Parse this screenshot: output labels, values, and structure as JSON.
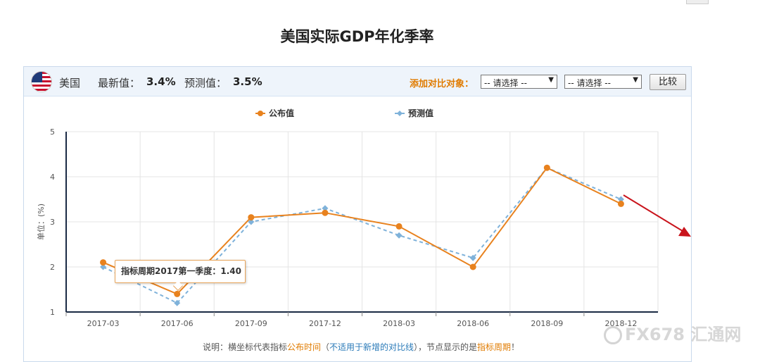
{
  "page": {
    "title": "美国实际GDP年化季率"
  },
  "header": {
    "country": "美国",
    "latest_label": "最新值：",
    "latest_value": "3.4%",
    "forecast_label": "预测值：",
    "forecast_value": "3.5%",
    "compare_label": "添加对比对象：",
    "select1": "-- 请选择 --",
    "select2": "-- 请选择 --",
    "compare_button": "比较"
  },
  "tooltip": {
    "text": "指标周期2017第一季度：1.40"
  },
  "note": {
    "p1": "说明：横坐标代表指标",
    "p2": "公布时间",
    "p3": "（",
    "p4": "不适用于新增的对比线",
    "p5": "），节点显示的是",
    "p6": "指标周期",
    "p7": "！"
  },
  "watermark": "FX678 汇通网",
  "colors": {
    "published": "#e8821e",
    "forecast": "#7fb2da",
    "arrow": "#c9141c"
  },
  "chart_data": {
    "type": "line",
    "categories": [
      "2017-03",
      "2017-06",
      "2017-09",
      "2017-12",
      "2018-03",
      "2018-06",
      "2018-09",
      "2018-12"
    ],
    "series": [
      {
        "name": "公布值",
        "values": [
          2.1,
          1.4,
          3.1,
          3.2,
          2.9,
          2.0,
          4.2,
          3.4
        ]
      },
      {
        "name": "预测值",
        "values": [
          2.0,
          1.2,
          3.0,
          3.3,
          2.7,
          2.2,
          4.2,
          3.5
        ]
      }
    ],
    "ylabel": "单位：(%)",
    "ylim": [
      1,
      5
    ],
    "yticks": [
      1,
      2,
      3,
      4,
      5
    ],
    "grid": true,
    "legend": "top"
  }
}
